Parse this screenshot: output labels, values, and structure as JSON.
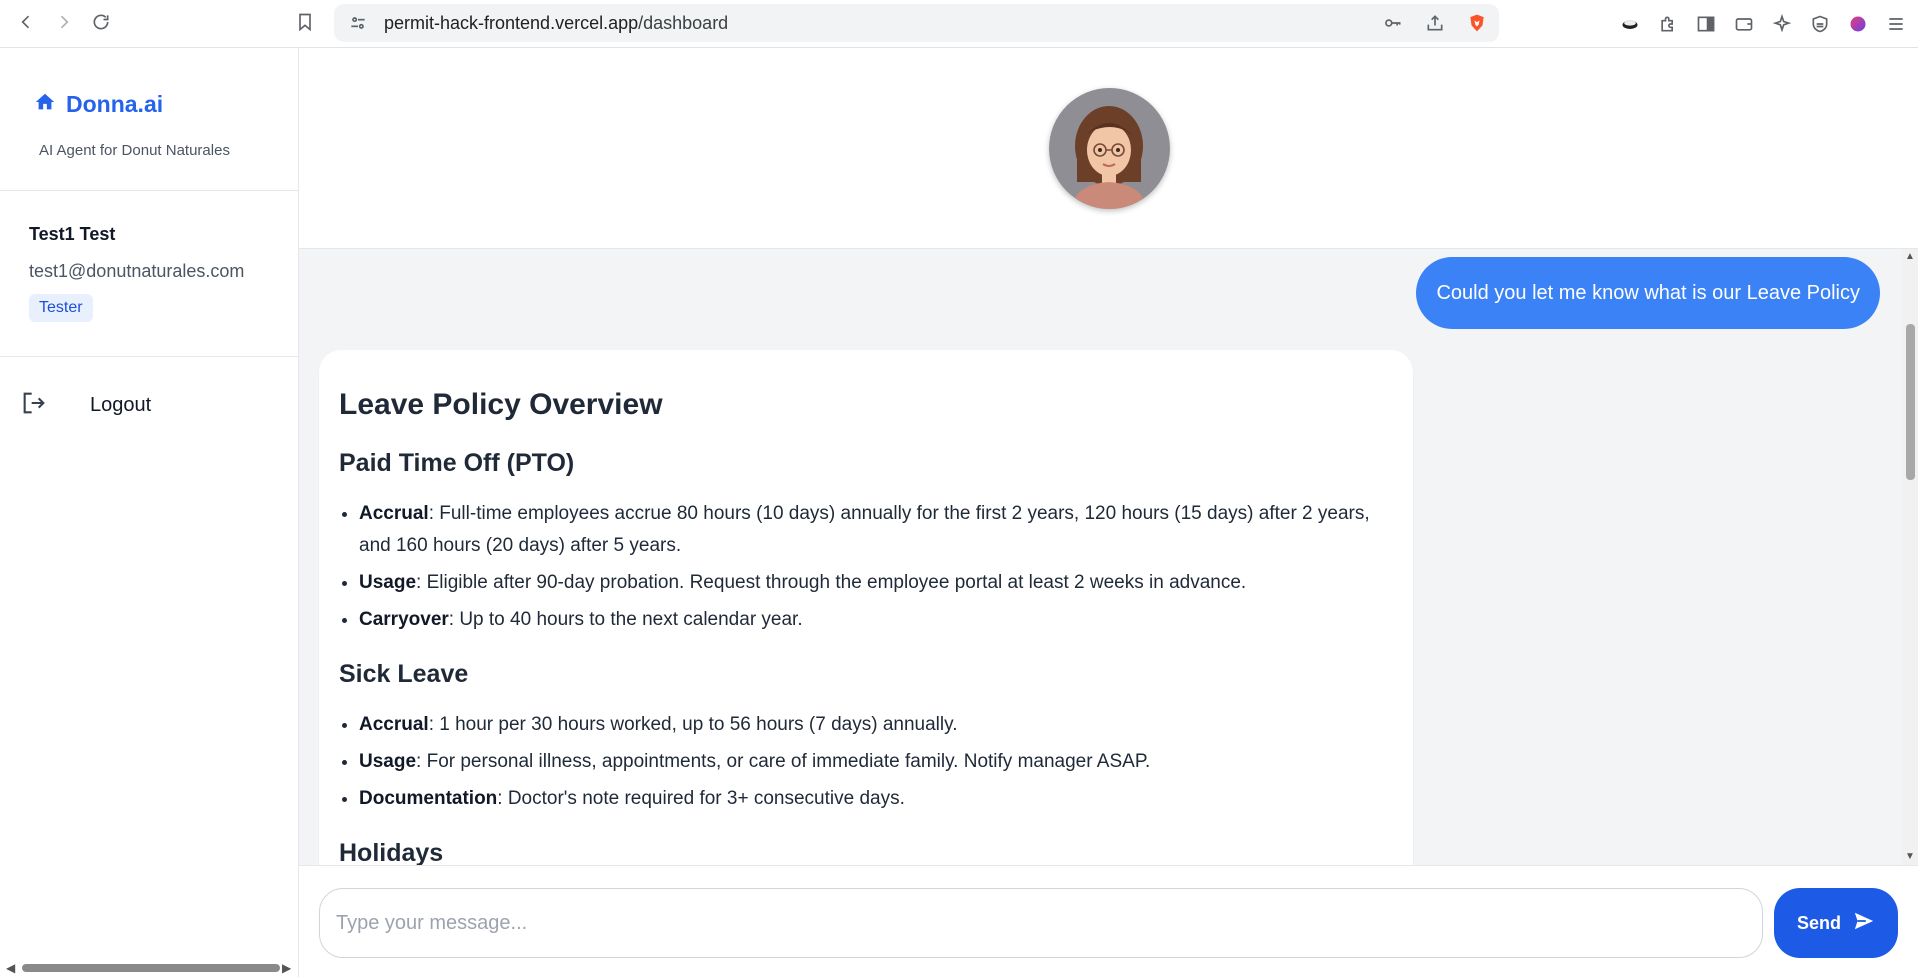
{
  "browser": {
    "url_host": "permit-hack-frontend.vercel.app",
    "url_path": "/dashboard"
  },
  "sidebar": {
    "brand": "Donna.ai",
    "subtitle": "AI Agent for Donut Naturales",
    "user": {
      "name": "Test1 Test",
      "email": "test1@donutnaturales.com",
      "role": "Tester"
    },
    "logout_label": "Logout"
  },
  "chat": {
    "user_message": "Could you let me know what is our Leave Policy",
    "response": {
      "title": "Leave Policy Overview",
      "sections": [
        {
          "heading": "Paid Time Off (PTO)",
          "items": [
            {
              "label": "Accrual",
              "text": ": Full-time employees accrue 80 hours (10 days) annually for the first 2 years, 120 hours (15 days) after 2 years, and 160 hours (20 days) after 5 years."
            },
            {
              "label": "Usage",
              "text": ": Eligible after 90-day probation. Request through the employee portal at least 2 weeks in advance."
            },
            {
              "label": "Carryover",
              "text": ": Up to 40 hours to the next calendar year."
            }
          ]
        },
        {
          "heading": "Sick Leave",
          "items": [
            {
              "label": "Accrual",
              "text": ": 1 hour per 30 hours worked, up to 56 hours (7 days) annually."
            },
            {
              "label": "Usage",
              "text": ": For personal illness, appointments, or care of immediate family. Notify manager ASAP."
            },
            {
              "label": "Documentation",
              "text": ": Doctor's note required for 3+ consecutive days."
            }
          ]
        },
        {
          "heading": "Holidays",
          "items": []
        }
      ]
    }
  },
  "composer": {
    "placeholder": "Type your message...",
    "send_label": "Send"
  },
  "colors": {
    "accent": "#2563eb",
    "user_bubble": "#3b82f6",
    "send_button": "#1d5be6",
    "chat_background": "#f3f4f6"
  }
}
